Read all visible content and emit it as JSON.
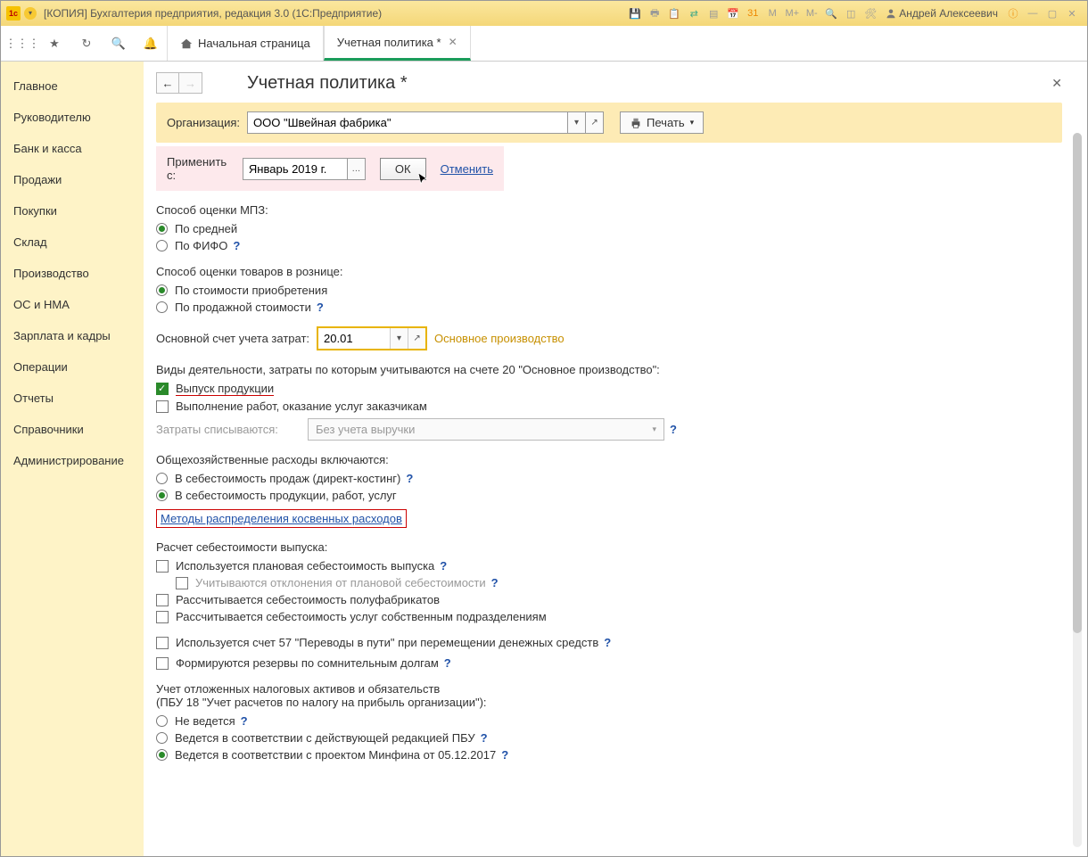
{
  "titlebar": {
    "title": "[КОПИЯ] Бухгалтерия предприятия, редакция 3.0  (1С:Предприятие)",
    "m": "M",
    "mplus": "M+",
    "mminus": "M-",
    "cal_day": "31",
    "user": "Андрей Алексеевич"
  },
  "tabs": {
    "home": "Начальная страница",
    "active": "Учетная политика *"
  },
  "sidebar": {
    "items": [
      "Главное",
      "Руководителю",
      "Банк и касса",
      "Продажи",
      "Покупки",
      "Склад",
      "Производство",
      "ОС и НМА",
      "Зарплата и кадры",
      "Операции",
      "Отчеты",
      "Справочники",
      "Администрирование"
    ]
  },
  "page": {
    "title": "Учетная политика *",
    "org_label": "Организация:",
    "org_value": "ООО \"Швейная фабрика\"",
    "print": "Печать",
    "apply_label": "Применить с:",
    "apply_value": "Январь 2019 г.",
    "ok": "ОК",
    "cancel": "Отменить",
    "mpz_head": "Способ оценки МПЗ:",
    "mpz_avg": "По средней",
    "mpz_fifo": "По ФИФО",
    "retail_head": "Способ оценки товаров в рознице:",
    "retail_cost": "По стоимости приобретения",
    "retail_sale": "По продажной стоимости",
    "acct_label": "Основной счет учета затрат:",
    "acct_value": "20.01",
    "acct_hint": "Основное производство",
    "activities_head": "Виды деятельности, затраты по которым учитываются на счете 20 \"Основное производство\":",
    "act_output": "Выпуск продукции",
    "act_services": "Выполнение работ, оказание услуг заказчикам",
    "writeoff_label": "Затраты списываются:",
    "writeoff_value": "Без учета выручки",
    "overhead_head": "Общехозяйственные расходы включаются:",
    "overhead_direct": "В себестоимость продаж (директ-костинг)",
    "overhead_prod": "В  себестоимость продукции, работ, услуг",
    "methods_link": "Методы распределения косвенных расходов",
    "cost_head": "Расчет себестоимости выпуска:",
    "cost_planned": "Используется плановая себестоимость выпуска",
    "cost_dev": "Учитываются отклонения от плановой себестоимости",
    "cost_semi": "Рассчитывается себестоимость полуфабрикатов",
    "cost_own": "Рассчитывается себестоимость услуг собственным подразделениям",
    "acc57": "Используется счет 57 \"Переводы в пути\" при перемещении денежных средств",
    "reserves": "Формируются резервы по сомнительным долгам",
    "pbu_head1": "Учет отложенных налоговых активов и обязательств",
    "pbu_head2": "(ПБУ 18 \"Учет расчетов по налогу на прибыль организации\"):",
    "pbu_none": "Не ведется",
    "pbu_std": "Ведется в соответствии с действующей редакцией ПБУ",
    "pbu_draft": "Ведется в соответствии с проектом Минфина от 05.12.2017",
    "q": "?"
  }
}
